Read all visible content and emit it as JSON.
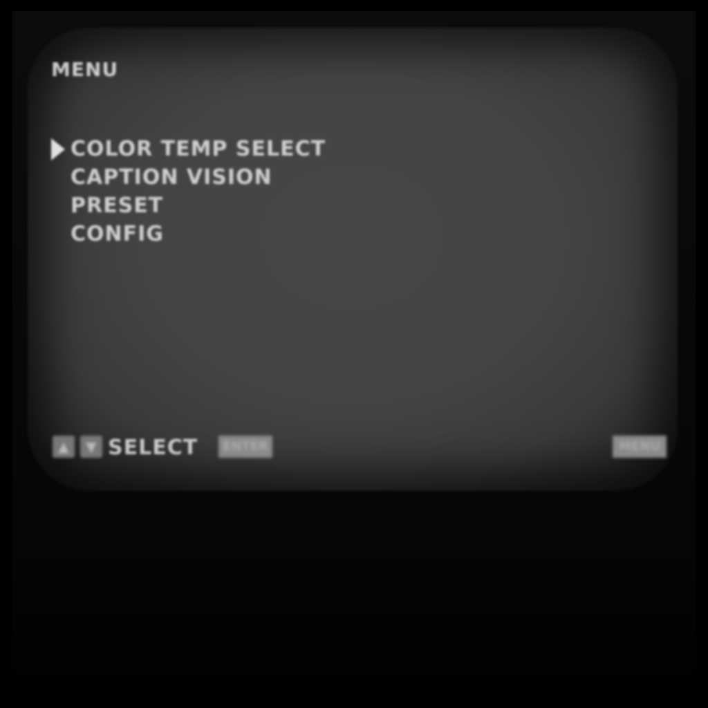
{
  "menu": {
    "title": "MENU",
    "items": [
      {
        "label": "COLOR TEMP SELECT",
        "selected": true
      },
      {
        "label": "CAPTION VISION",
        "selected": false
      },
      {
        "label": "PRESET",
        "selected": false
      },
      {
        "label": "CONFIG",
        "selected": false
      }
    ]
  },
  "footer": {
    "up_key": "▲",
    "down_key": "▼",
    "select_label": "SELECT",
    "enter_badge": "ENTER",
    "menu_badge": "MENU"
  }
}
